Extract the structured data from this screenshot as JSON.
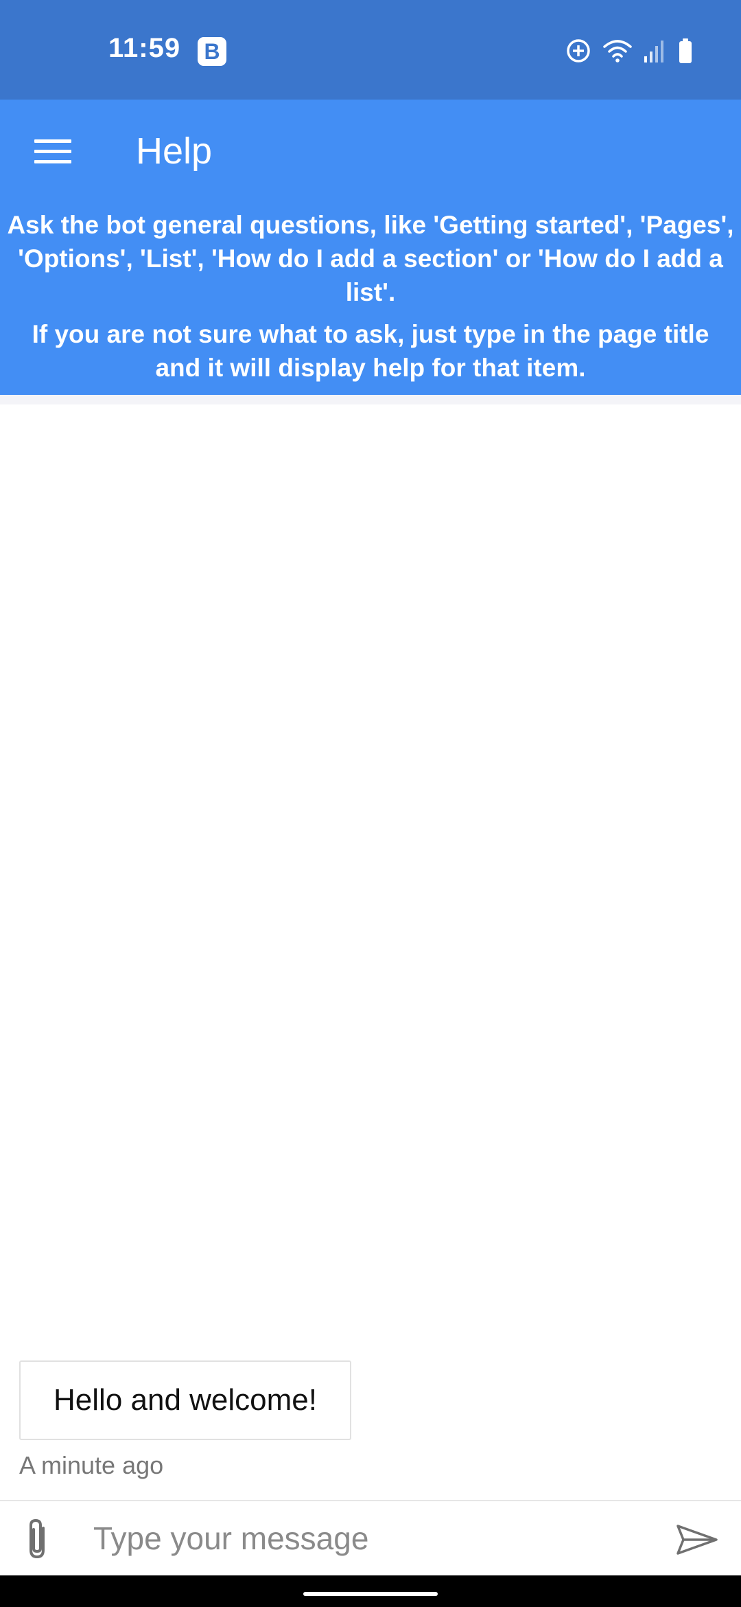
{
  "status_bar": {
    "time": "11:59",
    "badge": "B",
    "icons": [
      "data-saver-icon",
      "wifi-icon",
      "signal-icon",
      "battery-icon"
    ],
    "background": "#3b76cc"
  },
  "app_bar": {
    "title": "Help",
    "menu_icon": "hamburger-menu-icon",
    "background": "#438ef4",
    "help_lines": [
      "Ask the bot general questions, like 'Getting started', 'Pages', 'Options', 'List', 'How do I add a section' or 'How do I add a list'.",
      "If you are not sure what to ask, just type in the page title and it will display help for that item."
    ]
  },
  "chat": {
    "messages": [
      {
        "text": "Hello and welcome!",
        "timestamp": "A minute ago"
      }
    ]
  },
  "input_bar": {
    "placeholder": "Type your message",
    "value": "",
    "attach_icon": "paperclip-icon",
    "send_icon": "send-icon"
  }
}
